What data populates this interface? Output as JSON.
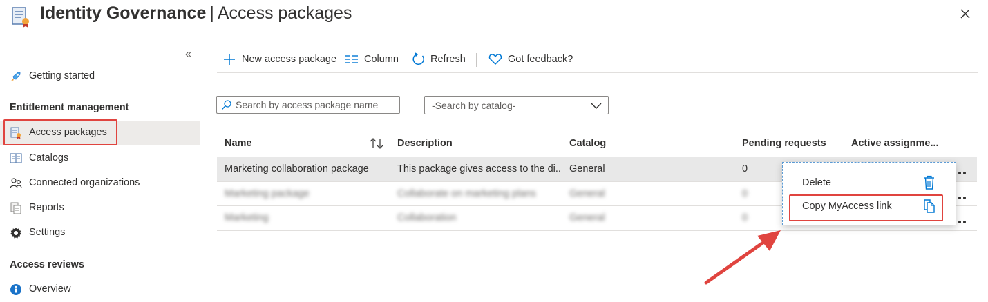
{
  "header": {
    "title_main": "Identity Governance",
    "separator": "|",
    "title_sub": "Access packages"
  },
  "sidebar": {
    "collapse_glyph": "«",
    "items": [
      {
        "label": "Getting started",
        "icon": "rocket-icon"
      },
      {
        "label": "Access packages",
        "icon": "access-package-icon",
        "active": true
      },
      {
        "label": "Catalogs",
        "icon": "catalog-icon"
      },
      {
        "label": "Connected organizations",
        "icon": "people-icon"
      },
      {
        "label": "Reports",
        "icon": "reports-icon"
      },
      {
        "label": "Settings",
        "icon": "gear-icon"
      },
      {
        "label": "Overview",
        "icon": "info-icon"
      }
    ],
    "sections": [
      "Entitlement management",
      "Access reviews"
    ]
  },
  "toolbar": {
    "new_label": "New access package",
    "column_label": "Column",
    "refresh_label": "Refresh",
    "feedback_label": "Got feedback?"
  },
  "filters": {
    "search_placeholder": "Search by access package name",
    "catalog_value": "-Search by catalog-"
  },
  "table": {
    "columns": [
      "Name",
      "Description",
      "Catalog",
      "Pending requests",
      "Active assignme..."
    ],
    "rows": [
      {
        "name": "Marketing collaboration package",
        "description": "This package gives access to the di...",
        "catalog": "General",
        "pending": "0"
      },
      {
        "name": "Marketing package",
        "description": "Collaborate on marketing plans",
        "catalog": "General",
        "pending": "0"
      },
      {
        "name": "Marketing",
        "description": "Collaboration",
        "catalog": "General",
        "pending": "0"
      }
    ]
  },
  "context_menu": {
    "items": [
      {
        "label": "Delete",
        "icon": "trash-icon"
      },
      {
        "label": "Copy MyAccess link",
        "icon": "copy-icon"
      }
    ]
  },
  "colors": {
    "accent": "#0078d4",
    "highlight_red": "#e0443f",
    "active_bg": "#edebe9"
  }
}
